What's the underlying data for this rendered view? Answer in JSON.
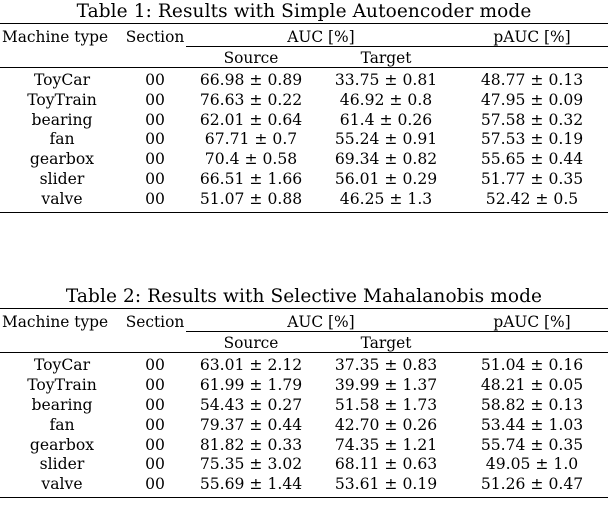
{
  "document": {
    "type": "paper-tables",
    "background_color": "#ffffff",
    "text_color": "#000000"
  },
  "tables": [
    {
      "caption": "Table 1: Results with Simple Autoencoder mode",
      "headers": {
        "machine_type": "Machine type",
        "section": "Section",
        "group_auc": "AUC [%]",
        "group_pauc": "pAUC [%]",
        "sub_source": "Source",
        "sub_target": "Target"
      },
      "rows": [
        {
          "machine_type": "ToyCar",
          "section": "00",
          "source": "66.98 ± 0.89",
          "target": "33.75 ± 0.81",
          "pauc": "48.77 ± 0.13"
        },
        {
          "machine_type": "ToyTrain",
          "section": "00",
          "source": "76.63 ± 0.22",
          "target": "46.92 ± 0.8",
          "pauc": "47.95 ± 0.09"
        },
        {
          "machine_type": "bearing",
          "section": "00",
          "source": "62.01 ± 0.64",
          "target": "61.4 ± 0.26",
          "pauc": "57.58 ± 0.32"
        },
        {
          "machine_type": "fan",
          "section": "00",
          "source": "67.71 ± 0.7",
          "target": "55.24 ± 0.91",
          "pauc": "57.53 ± 0.19"
        },
        {
          "machine_type": "gearbox",
          "section": "00",
          "source": "70.4 ± 0.58",
          "target": "69.34 ± 0.82",
          "pauc": "55.65 ± 0.44"
        },
        {
          "machine_type": "slider",
          "section": "00",
          "source": "66.51 ± 1.66",
          "target": "56.01 ± 0.29",
          "pauc": "51.77 ± 0.35"
        },
        {
          "machine_type": "valve",
          "section": "00",
          "source": "51.07 ± 0.88",
          "target": "46.25 ± 1.3",
          "pauc": "52.42 ± 0.5"
        }
      ]
    },
    {
      "caption": "Table 2: Results with Selective Mahalanobis mode",
      "headers": {
        "machine_type": "Machine type",
        "section": "Section",
        "group_auc": "AUC [%]",
        "group_pauc": "pAUC [%]",
        "sub_source": "Source",
        "sub_target": "Target"
      },
      "rows": [
        {
          "machine_type": "ToyCar",
          "section": "00",
          "source": "63.01 ± 2.12",
          "target": "37.35 ± 0.83",
          "pauc": "51.04 ± 0.16"
        },
        {
          "machine_type": "ToyTrain",
          "section": "00",
          "source": "61.99 ± 1.79",
          "target": "39.99 ± 1.37",
          "pauc": "48.21 ± 0.05"
        },
        {
          "machine_type": "bearing",
          "section": "00",
          "source": "54.43 ± 0.27",
          "target": "51.58 ± 1.73",
          "pauc": "58.82 ± 0.13"
        },
        {
          "machine_type": "fan",
          "section": "00",
          "source": "79.37 ± 0.44",
          "target": "42.70 ± 0.26",
          "pauc": "53.44 ± 1.03"
        },
        {
          "machine_type": "gearbox",
          "section": "00",
          "source": "81.82 ± 0.33",
          "target": "74.35 ± 1.21",
          "pauc": "55.74 ± 0.35"
        },
        {
          "machine_type": "slider",
          "section": "00",
          "source": "75.35 ± 3.02",
          "target": "68.11 ± 0.63",
          "pauc": "49.05 ± 1.0"
        },
        {
          "machine_type": "valve",
          "section": "00",
          "source": "55.69 ± 1.44",
          "target": "53.61 ± 0.19",
          "pauc": "51.26 ± 0.47"
        }
      ]
    }
  ]
}
